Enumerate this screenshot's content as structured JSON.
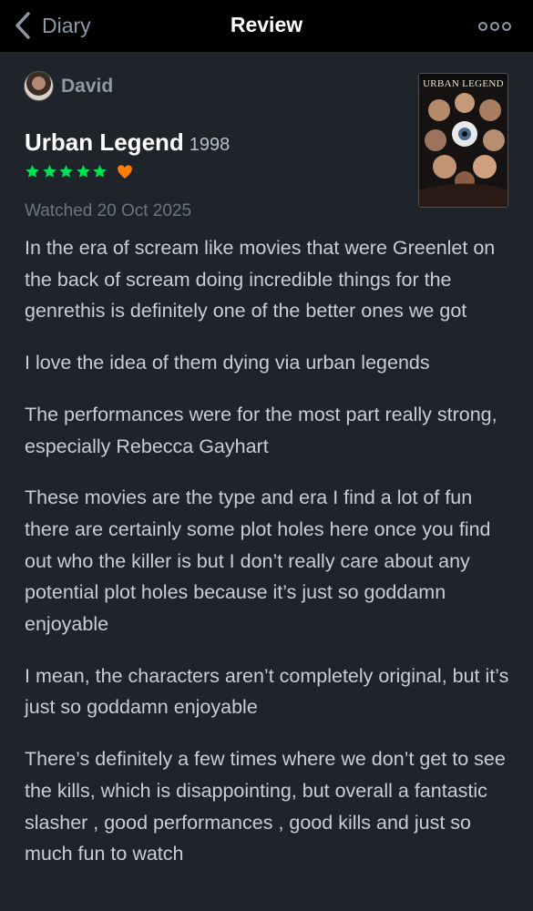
{
  "header": {
    "back_label": "Diary",
    "title": "Review"
  },
  "review": {
    "author": "David",
    "movie_title": "Urban Legend",
    "year": "1998",
    "stars": 5,
    "liked": true,
    "watched": "Watched 20 Oct 2025",
    "poster_title": "URBAN LEGEND",
    "paragraphs": [
      "In the era of scream like movies that were Greenlet on the back of scream doing incredible things for the genrethis is definitely one of the better ones we got",
      "I love the idea of them dying via urban legends",
      "The performances were for the most part really strong, especially Rebecca Gayhart",
      "These movies are the type and era I find a lot of fun there are certainly some plot holes here once you find out who the killer is but I don’t really care about any potential plot holes because it’s just so goddamn enjoyable",
      "I mean, the characters aren’t completely original, but it’s just so goddamn enjoyable",
      "There’s definitely a few times where we don’t get to see the kills, which is disappointing, but overall a fantastic slasher , good performances , good kills and just so much fun to watch"
    ]
  },
  "colors": {
    "star": "#00e054",
    "heart": "#ff8000"
  }
}
